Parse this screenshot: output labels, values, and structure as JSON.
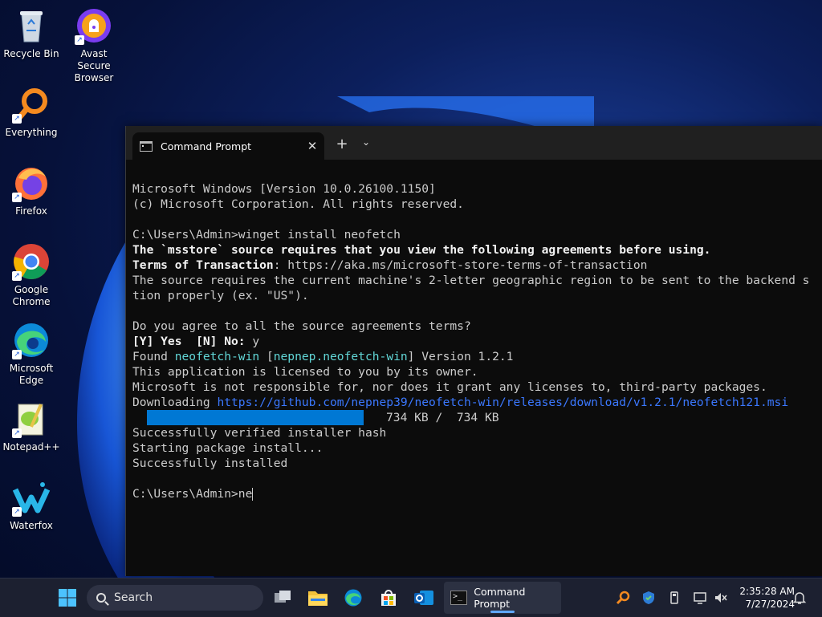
{
  "desktop": {
    "icons": [
      {
        "label": "Recycle Bin",
        "icon": "recycle-bin-icon"
      },
      {
        "label": "Avast Secure\nBrowser",
        "icon": "avast-browser-icon"
      },
      {
        "label": "Everything",
        "icon": "everything-search-icon"
      },
      {
        "label": "Firefox",
        "icon": "firefox-icon"
      },
      {
        "label": "Google\nChrome",
        "icon": "chrome-icon"
      },
      {
        "label": "Microsoft\nEdge",
        "icon": "edge-icon"
      },
      {
        "label": "Notepad++",
        "icon": "notepad-plus-plus-icon"
      },
      {
        "label": "Waterfox",
        "icon": "waterfox-icon"
      }
    ]
  },
  "terminal": {
    "tab_title": "Command Prompt",
    "close_glyph": "✕",
    "new_tab_glyph": "+",
    "dropdown_glyph": "⌄",
    "lines": {
      "l1": "Microsoft Windows [Version 10.0.26100.1150]",
      "l2": "(c) Microsoft Corporation. All rights reserved.",
      "l4": "C:\\Users\\Admin>winget install neofetch",
      "l5": "The `msstore` source requires that you view the following agreements before using.",
      "l6a": "Terms of Transaction",
      "l6b": ": https://aka.ms/microsoft-store-terms-of-transaction",
      "l7": "The source requires the current machine's 2-letter geographic region to be sent to the backend s",
      "l8": "tion properly (ex. \"US\").",
      "l10": "Do you agree to all the source agreements terms?",
      "l11a": "[Y] Yes  [N] No: ",
      "l11b": "y",
      "l12a": "Found ",
      "l12b": "neofetch-win",
      "l12c": " [",
      "l12d": "nepnep.neofetch-win",
      "l12e": "] Version 1.2.1",
      "l13": "This application is licensed to you by its owner.",
      "l14": "Microsoft is not responsible for, nor does it grant any licenses to, third-party packages.",
      "l15a": "Downloading ",
      "l15b": "https://github.com/nepnep39/neofetch-win/releases/download/v1.2.1/neofetch121.msi",
      "l16": "734 KB /  734 KB",
      "l17": "Successfully verified installer hash",
      "l18": "Starting package install...",
      "l19": "Successfully installed",
      "l21": "C:\\Users\\Admin>ne"
    },
    "download_progress": 1.0,
    "colors": {
      "background": "#0c0c0c",
      "text": "#cccccc",
      "highlight": "#61d6d6",
      "link": "#3b78ff",
      "progress": "#0078d4"
    }
  },
  "taskbar": {
    "search_placeholder": "Search",
    "active_app_label": "Command Prompt",
    "pinned": [
      "windows-start-icon",
      "task-view-icon",
      "file-explorer-icon",
      "edge-icon",
      "microsoft-store-icon",
      "outlook-icon"
    ],
    "tray": [
      "everything-tray-icon",
      "defender-icon",
      "usb-icon",
      "network-icon",
      "volume-muted-icon",
      "notification-bell-icon"
    ],
    "time": "2:35:28 AM",
    "date": "7/27/2024"
  }
}
